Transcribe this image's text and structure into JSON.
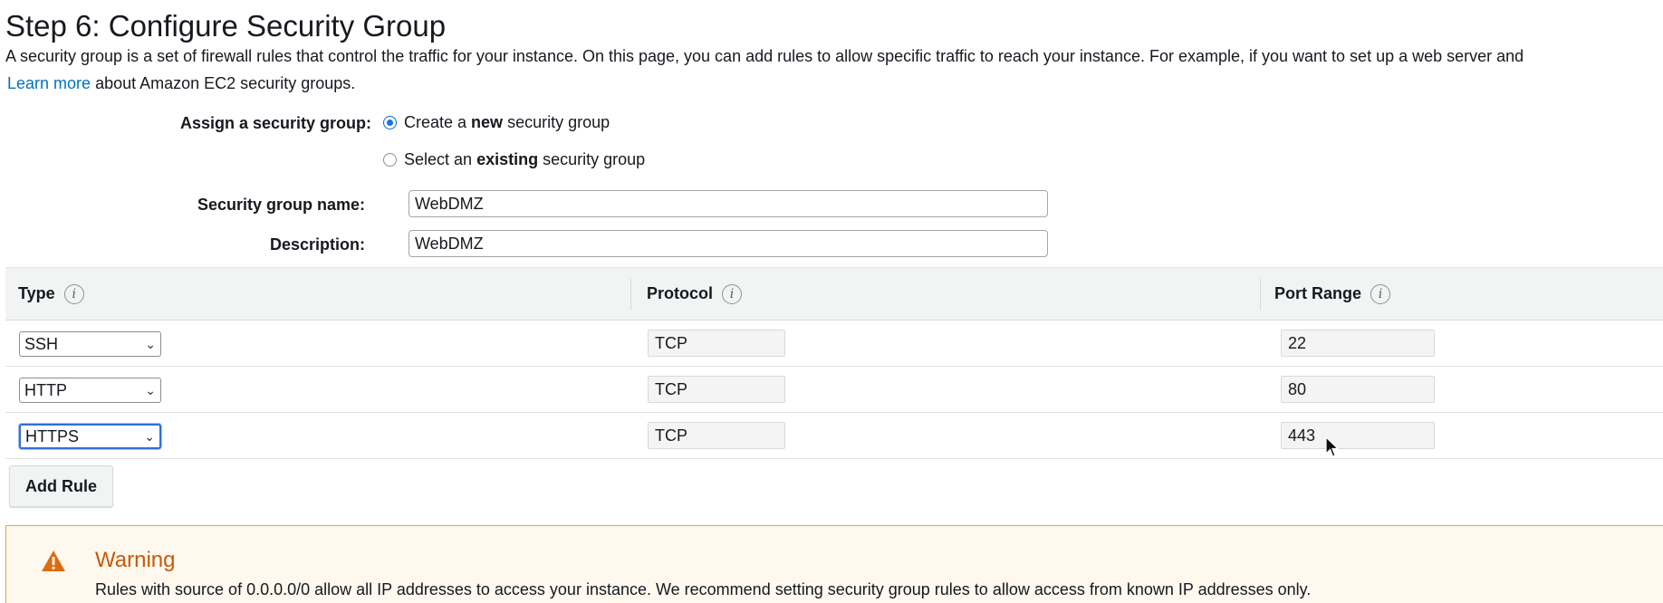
{
  "page": {
    "title": "Step 6: Configure Security Group",
    "intro": "A security group is a set of firewall rules that control the traffic for your instance. On this page, you can add rules to allow specific traffic to reach your instance. For example, if you want to set up a web server and",
    "learn_more_link": "Learn more",
    "learn_more_suffix": "about Amazon EC2 security groups."
  },
  "assign": {
    "label": "Assign a security group:",
    "option_new": {
      "pre": "Create a ",
      "bold": "new",
      "post": " security group",
      "selected": true
    },
    "option_existing": {
      "pre": "Select an ",
      "bold": "existing",
      "post": " security group",
      "selected": false
    }
  },
  "fields": {
    "name_label": "Security group name:",
    "name_value": "WebDMZ",
    "description_label": "Description:",
    "description_value": "WebDMZ"
  },
  "table": {
    "headers": {
      "type": "Type",
      "protocol": "Protocol",
      "port_range": "Port Range",
      "info_icon": "i"
    },
    "rows": [
      {
        "type": "SSH",
        "protocol": "TCP",
        "port": "22"
      },
      {
        "type": "HTTP",
        "protocol": "TCP",
        "port": "80"
      },
      {
        "type": "HTTPS",
        "protocol": "TCP",
        "port": "443"
      }
    ]
  },
  "buttons": {
    "add_rule": "Add Rule"
  },
  "warning": {
    "title": "Warning",
    "text": "Rules with source of 0.0.0.0/0 allow all IP addresses to access your instance. We recommend setting security group rules to allow access from known IP addresses only.",
    "color": "#c45b0a",
    "icon": "warning-triangle-icon"
  },
  "colors": {
    "link": "#0073bb",
    "radio_selected": "#1a73e8",
    "header_bg": "#f2f3f3"
  }
}
